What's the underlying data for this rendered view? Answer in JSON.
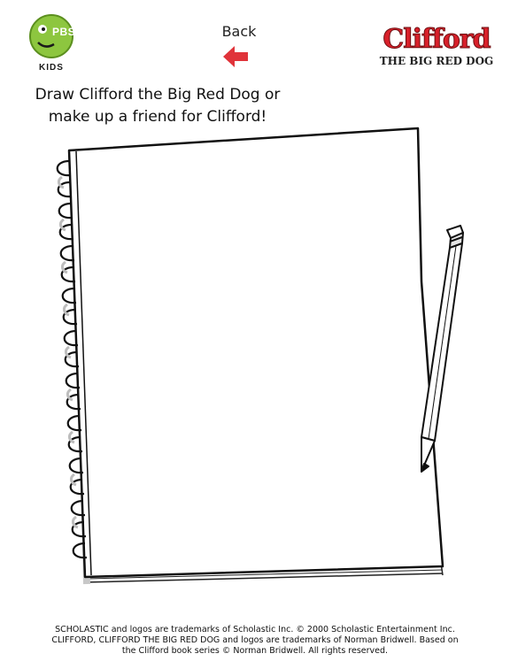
{
  "header": {
    "pbs_logo": {
      "wordmark": "PBS",
      "subtext": "KIDS",
      "color": "#8dc63f"
    },
    "back_link": {
      "label": "Back",
      "icon": "left-arrow-icon",
      "arrow_color": "#e0333a"
    },
    "brand_logo": {
      "title": "Clifford",
      "subtitle": "THE BIG RED DOG",
      "color": "#d8202a"
    }
  },
  "main": {
    "instructions": {
      "line_1": "Draw Clifford the Big Red Dog or",
      "line_2": "make up a friend for Clifford!"
    },
    "drawing_area": {
      "notebook_icon": "spiral-notebook-icon",
      "pencil_icon": "pencil-icon"
    }
  },
  "footer": {
    "copyright_line_1": "SCHOLASTIC and logos are trademarks of Scholastic Inc. © 2000 Scholastic Entertainment Inc.",
    "copyright_line_2": "CLIFFORD, CLIFFORD THE BIG RED DOG and logos are trademarks of Norman Bridwell. Based on",
    "copyright_line_3": "the Clifford book series © Norman Bridwell. All rights reserved."
  }
}
